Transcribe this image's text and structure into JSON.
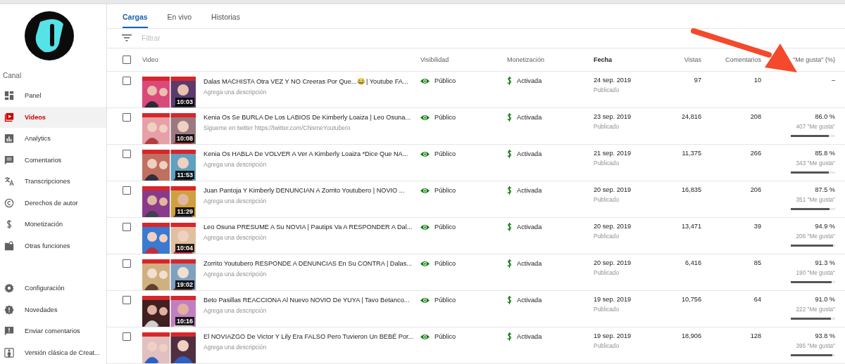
{
  "sidebar": {
    "section": "Canal",
    "items": [
      {
        "label": "Panel",
        "selected": false
      },
      {
        "label": "Videos",
        "selected": true
      },
      {
        "label": "Analytics",
        "selected": false
      },
      {
        "label": "Comentarios",
        "selected": false
      },
      {
        "label": "Transcripciones",
        "selected": false
      },
      {
        "label": "Derechos de autor",
        "selected": false
      },
      {
        "label": "Monetización",
        "selected": false
      },
      {
        "label": "Otras funciones",
        "selected": false
      }
    ],
    "bottom_items": [
      {
        "label": "Configuración"
      },
      {
        "label": "Novedades"
      },
      {
        "label": "Enviar comentarios"
      },
      {
        "label": "Versión clásica de Creat..."
      }
    ]
  },
  "tabs": [
    {
      "label": "Cargas",
      "selected": true
    },
    {
      "label": "En vivo",
      "selected": false
    },
    {
      "label": "Historias",
      "selected": false
    }
  ],
  "filter": {
    "placeholder": "Filtrar"
  },
  "table": {
    "select_all_checked": false,
    "columns": [
      {
        "label": "Video",
        "bold": false
      },
      {
        "label": "Visibilidad",
        "bold": false
      },
      {
        "label": "Monetización",
        "bold": false
      },
      {
        "label": "Fecha",
        "bold": true
      },
      {
        "label": "Vistas",
        "bold": false
      },
      {
        "label": "Comentarios",
        "bold": false
      },
      {
        "label": "\"Me gusta\" (%)",
        "bold": false
      }
    ],
    "rows": [
      {
        "checked": false,
        "duration": "10:03",
        "title": "Dalas MACHISTA Otra VEZ Y NO Creeras Por Que...😂 | Youtube FA...",
        "description": "Agrega una descripción",
        "visibility": "Público",
        "monetization": "Activada",
        "date": "24 sep. 2019",
        "status": "Publicado",
        "views": "97",
        "comments": "10",
        "likes_pct": "–"
      },
      {
        "checked": false,
        "duration": "10:08",
        "title": "Kenia Os Se BURLA De Los LABIOS De Kimberly Loaiza | Leo Osuna...",
        "description": "Sigueme en twitter https://twitter.com/ChismeYoutubero",
        "visibility": "Público",
        "monetization": "Activada",
        "date": "23 sep. 2019",
        "status": "Publicado",
        "views": "24,816",
        "comments": "208",
        "likes_pct": "86.0 %",
        "likes_count": "407 \"Me gusta\"",
        "level": 0.86
      },
      {
        "checked": false,
        "duration": "11:53",
        "title": "Kenia Os HABLA De VOLVER A Ver A Kimberly Loaiza *Dice Que NA...",
        "description": "Agrega una descripción",
        "visibility": "Público",
        "monetization": "Activada",
        "date": "21 sep. 2019",
        "status": "Publicado",
        "views": "11,375",
        "comments": "266",
        "likes_pct": "85.8 %",
        "likes_count": "343 \"Me gusta\"",
        "level": 0.858
      },
      {
        "checked": false,
        "duration": "11:29",
        "title": "Juan Pantoja Y Kimberly DENUNCIAN A Zorrito Youtubero | NOVIO ...",
        "description": "Agrega una descripción",
        "visibility": "Público",
        "monetization": "Activada",
        "date": "20 sep. 2019",
        "status": "Publicado",
        "views": "16,835",
        "comments": "206",
        "likes_pct": "87.5 %",
        "likes_count": "351 \"Me gusta\"",
        "level": 0.875
      },
      {
        "checked": false,
        "duration": "10:04",
        "title": "Leo Osuna PRESUME A Su NOVIA | Pautips Va A RESPONDER A Dal...",
        "description": "Agrega una descripción",
        "visibility": "Público",
        "monetization": "Activada",
        "date": "20 sep. 2019",
        "status": "Publicado",
        "views": "13,471",
        "comments": "39",
        "likes_pct": "94.9 %",
        "likes_count": "206 \"Me gusta\"",
        "level": 0.949
      },
      {
        "checked": false,
        "duration": "19:02",
        "title": "Zorrito Youtubero RESPONDE A DENUNCIAS En Su CONTRA | Dalas...",
        "description": "Agrega una descripción",
        "visibility": "Público",
        "monetization": "Activada",
        "date": "20 sep. 2019",
        "status": "Publicado",
        "views": "6,416",
        "comments": "85",
        "likes_pct": "91.3 %",
        "likes_count": "190 \"Me gusta\"",
        "level": 0.913
      },
      {
        "checked": false,
        "duration": "10:16",
        "title": "Beto Pasillas REACCIONA Al Nuevo NOVIO De YUYA | Tavo Betanco...",
        "description": "Agrega una descripción",
        "visibility": "Público",
        "monetization": "Activada",
        "date": "19 sep. 2019",
        "status": "Publicado",
        "views": "10,756",
        "comments": "64",
        "likes_pct": "91.0 %",
        "likes_count": "222 \"Me gusta\"",
        "level": 0.91
      },
      {
        "checked": false,
        "title": "El NOVIAZGO De Victor Y Lily Era FALSO Pero Tuvieron Un BEBÉ Por...",
        "description": "Agrega una descripción",
        "visibility": "Público",
        "monetization": "Activada",
        "date": "19 sep. 2019",
        "status": "Publicado",
        "views": "18,906",
        "comments": "128",
        "likes_pct": "93.8 %",
        "likes_count": "395 \"Me gusta\"",
        "level": 0.938
      }
    ]
  }
}
